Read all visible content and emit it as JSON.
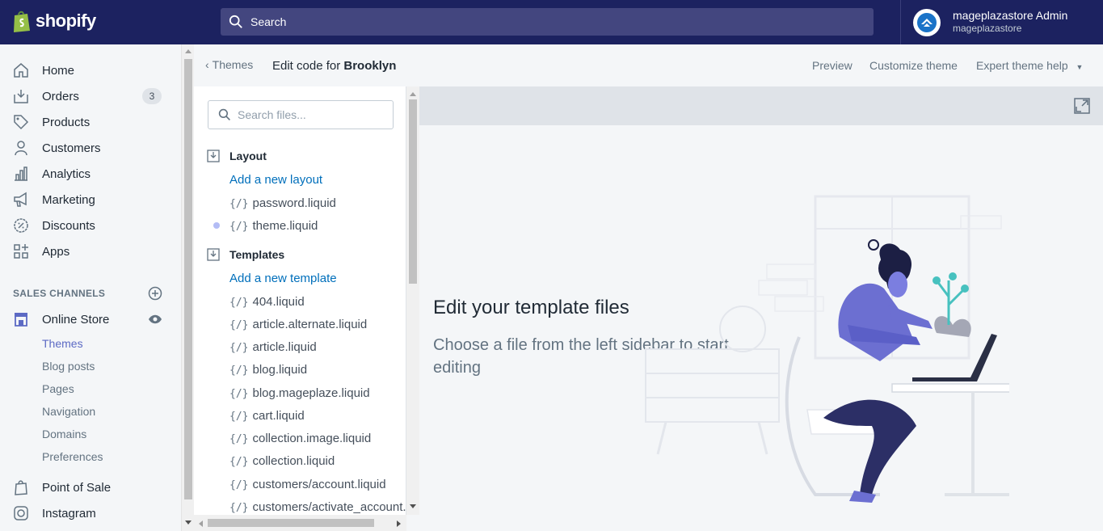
{
  "topbar": {
    "brand": "shopify",
    "search_placeholder": "Search",
    "account_name": "mageplazastore Admin",
    "account_store": "mageplazastore"
  },
  "sidebar": {
    "items": [
      {
        "label": "Home",
        "icon": "home-icon"
      },
      {
        "label": "Orders",
        "icon": "orders-icon",
        "badge": "3"
      },
      {
        "label": "Products",
        "icon": "tag-icon"
      },
      {
        "label": "Customers",
        "icon": "person-icon"
      },
      {
        "label": "Analytics",
        "icon": "bar-chart-icon"
      },
      {
        "label": "Marketing",
        "icon": "megaphone-icon"
      },
      {
        "label": "Discounts",
        "icon": "discount-icon"
      },
      {
        "label": "Apps",
        "icon": "apps-icon"
      }
    ],
    "sales_channels_title": "SALES CHANNELS",
    "online_store": "Online Store",
    "online_store_sub": [
      "Themes",
      "Blog posts",
      "Pages",
      "Navigation",
      "Domains",
      "Preferences"
    ],
    "point_of_sale": "Point of Sale",
    "instagram": "Instagram"
  },
  "header": {
    "back_label": "Themes",
    "title_prefix": "Edit code for ",
    "theme_name": "Brooklyn",
    "preview": "Preview",
    "customize": "Customize theme",
    "expert_help": "Expert theme help"
  },
  "files": {
    "search_placeholder": "Search files...",
    "layout_title": "Layout",
    "add_layout": "Add a new layout",
    "layout_files": [
      "password.liquid",
      "theme.liquid"
    ],
    "templates_title": "Templates",
    "add_template": "Add a new template",
    "template_files": [
      "404.liquid",
      "article.alternate.liquid",
      "article.liquid",
      "blog.liquid",
      "blog.mageplaze.liquid",
      "cart.liquid",
      "collection.image.liquid",
      "collection.liquid",
      "customers/account.liquid",
      "customers/activate_account.liquid"
    ]
  },
  "editor": {
    "title": "Edit your template files",
    "subtitle": "Choose a file from the left sidebar to start editing"
  },
  "colors": {
    "topbar": "#1c2260",
    "link": "#006fbb",
    "accent": "#5c6ac4"
  }
}
